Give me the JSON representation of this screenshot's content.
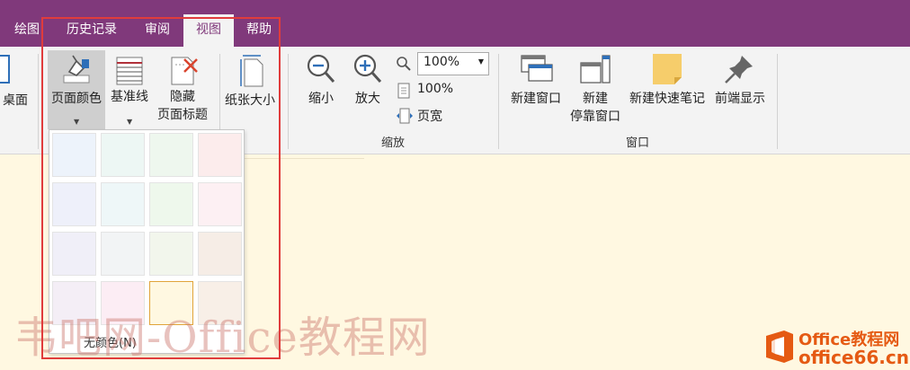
{
  "tabs": [
    {
      "label": "绘图",
      "active": false
    },
    {
      "label": "历史记录",
      "active": false
    },
    {
      "label": "审阅",
      "active": false
    },
    {
      "label": "视图",
      "active": true
    },
    {
      "label": "帮助",
      "active": false
    }
  ],
  "ribbon": {
    "desktop_label": "桌面",
    "page_color_label": "页面颜色",
    "rule_lines_label": "基准线",
    "hide_title_label_1": "隐藏",
    "hide_title_label_2": "页面标题",
    "paper_size_label": "纸张大小",
    "zoom_out_label": "缩小",
    "zoom_in_label": "放大",
    "zoom_value": "100%",
    "zoom_100_label": "100%",
    "page_width_label": "页宽",
    "zoom_group_label": "缩放",
    "new_window_label": "新建窗口",
    "new_docked_label_1": "新建",
    "new_docked_label_2": "停靠窗口",
    "new_quick_note_label": "新建快速笔记",
    "always_on_top_label": "前端显示",
    "window_group_label": "窗口"
  },
  "page_color_dropdown": {
    "swatches": [
      "#edf3fb",
      "#edf7f4",
      "#eef7ee",
      "#fcecec",
      "#eef0fa",
      "#eef7f8",
      "#eef8ec",
      "#fdf0f3",
      "#f0eff8",
      "#f2f4f5",
      "#f2f6ec",
      "#f6ede6",
      "#f4eef6",
      "#fcedf4",
      "#fff8e1",
      "#f8efe7"
    ],
    "selected_index": 14,
    "no_color_label": "无颜色(N)"
  },
  "watermark": "韦吧网-Office教程网",
  "logo": {
    "line1": "Office教程网",
    "line2": "office66.cn"
  },
  "colors": {
    "title_bar": "#80397b",
    "highlight_box": "#e03c3c",
    "page_background": "#fff8e1"
  }
}
